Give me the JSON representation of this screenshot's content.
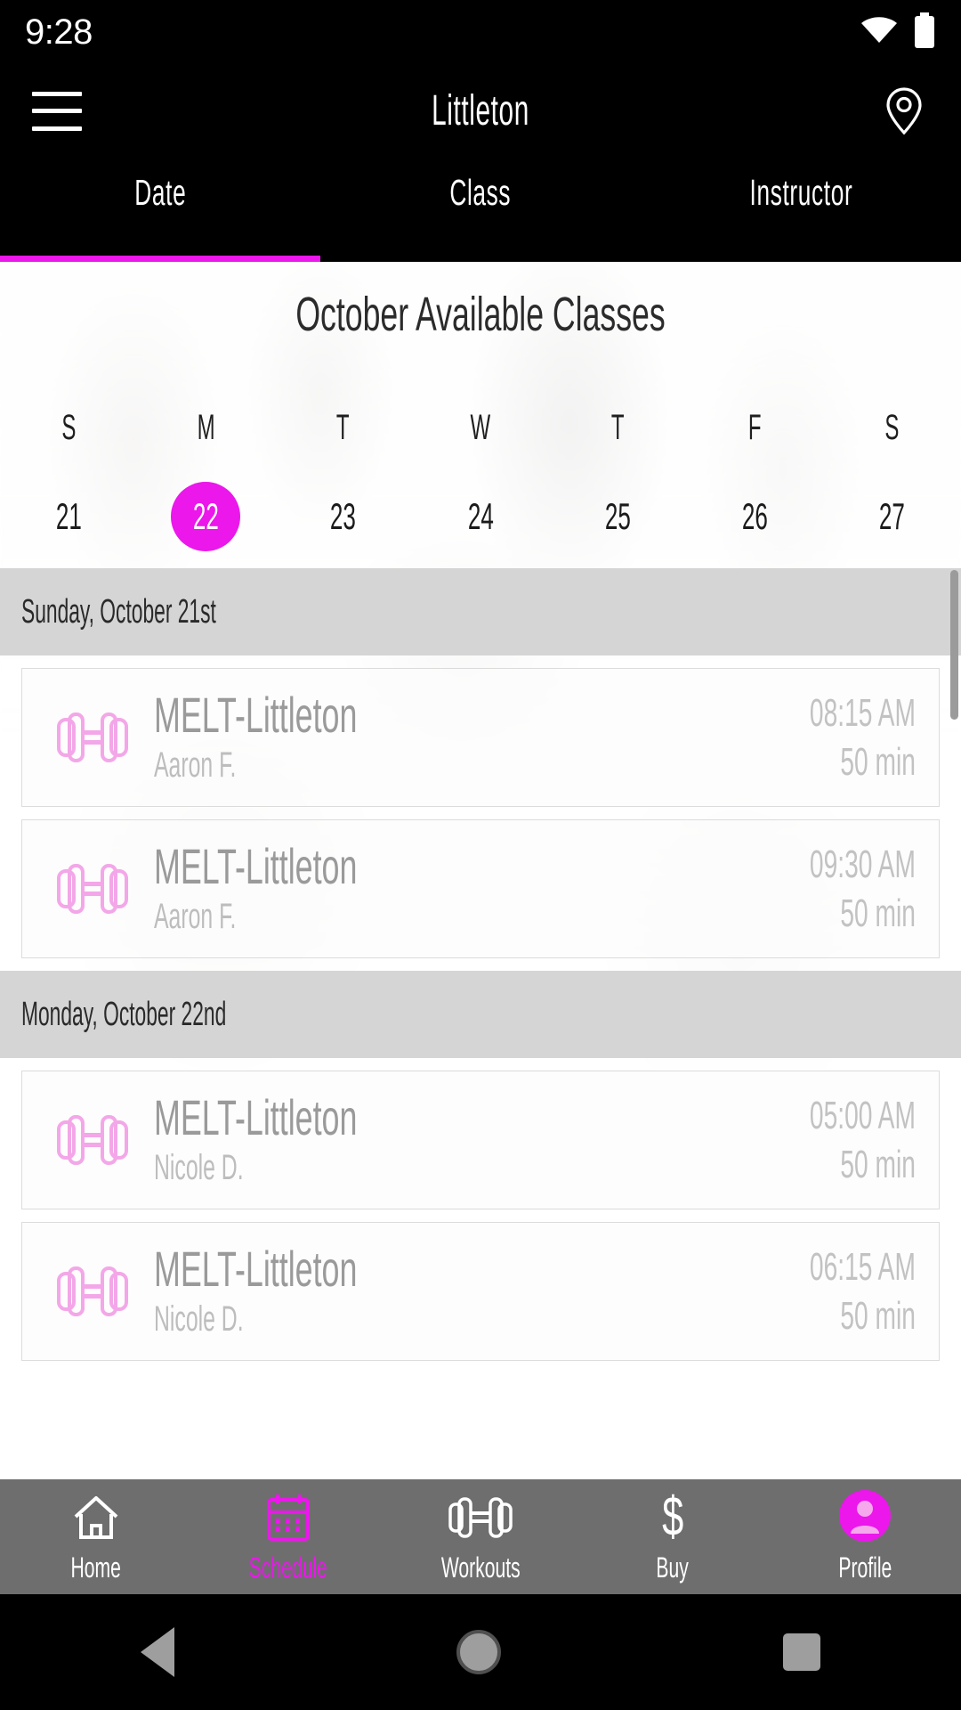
{
  "status_bar": {
    "time": "9:28",
    "wifi_icon": "wifi-icon",
    "battery_icon": "battery-icon"
  },
  "app_bar": {
    "menu_icon": "hamburger-menu-icon",
    "title": "Littleton",
    "location_icon": "location-pin-icon"
  },
  "tabs": {
    "active": "Date",
    "accent_color": "#EB17EB",
    "items": [
      {
        "label": "Date",
        "active": true
      },
      {
        "label": "Class",
        "active": false
      },
      {
        "label": "Instructor",
        "active": false
      }
    ]
  },
  "calendar": {
    "title": "October Available Classes",
    "day_initials": [
      "S",
      "M",
      "T",
      "W",
      "T",
      "F",
      "S"
    ],
    "dates": [
      "21",
      "22",
      "23",
      "24",
      "25",
      "26",
      "27"
    ],
    "selected_date": "22",
    "selected_color": "#EB17EB"
  },
  "schedule": {
    "sections": [
      {
        "header": "Sunday, October 21st",
        "classes": [
          {
            "icon": "dumbbell-icon",
            "name": "MELT-Littleton",
            "instructor": "Aaron F.",
            "time": "08:15 AM",
            "duration": "50 min"
          },
          {
            "icon": "dumbbell-icon",
            "name": "MELT-Littleton",
            "instructor": "Aaron F.",
            "time": "09:30 AM",
            "duration": "50 min"
          }
        ]
      },
      {
        "header": "Monday, October 22nd",
        "classes": [
          {
            "icon": "dumbbell-icon",
            "name": "MELT-Littleton",
            "instructor": "Nicole D.",
            "time": "05:00 AM",
            "duration": "50 min"
          },
          {
            "icon": "dumbbell-icon",
            "name": "MELT-Littleton",
            "instructor": "Nicole D.",
            "time": "06:15 AM",
            "duration": "50 min"
          }
        ]
      }
    ]
  },
  "bottom_nav": {
    "active": "Schedule",
    "active_color": "#EB17EB",
    "items": [
      {
        "label": "Home",
        "icon": "home-icon",
        "active": false
      },
      {
        "label": "Schedule",
        "icon": "calendar-icon",
        "active": true
      },
      {
        "label": "Workouts",
        "icon": "dumbbell-icon",
        "active": false
      },
      {
        "label": "Buy",
        "icon": "dollar-sign-icon",
        "active": false
      },
      {
        "label": "Profile",
        "icon": "person-avatar-icon",
        "active": false
      }
    ]
  },
  "system_nav": {
    "back_icon": "back-triangle-icon",
    "home_icon": "home-circle-icon",
    "recents_icon": "recents-square-icon"
  }
}
